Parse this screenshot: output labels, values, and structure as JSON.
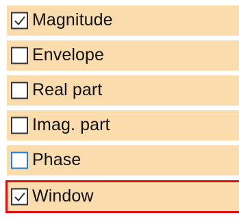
{
  "colors": {
    "row_background": "#fadcad",
    "highlight_border": "#e01010",
    "focus_border": "#1e7fd8"
  },
  "options": [
    {
      "label": "Magnitude",
      "checked": true
    },
    {
      "label": "Envelope",
      "checked": false
    },
    {
      "label": "Real part",
      "checked": false
    },
    {
      "label": "Imag. part",
      "checked": false
    },
    {
      "label": "Phase",
      "checked": false,
      "focused": true
    },
    {
      "label": "Window",
      "checked": true,
      "highlighted": true
    }
  ]
}
